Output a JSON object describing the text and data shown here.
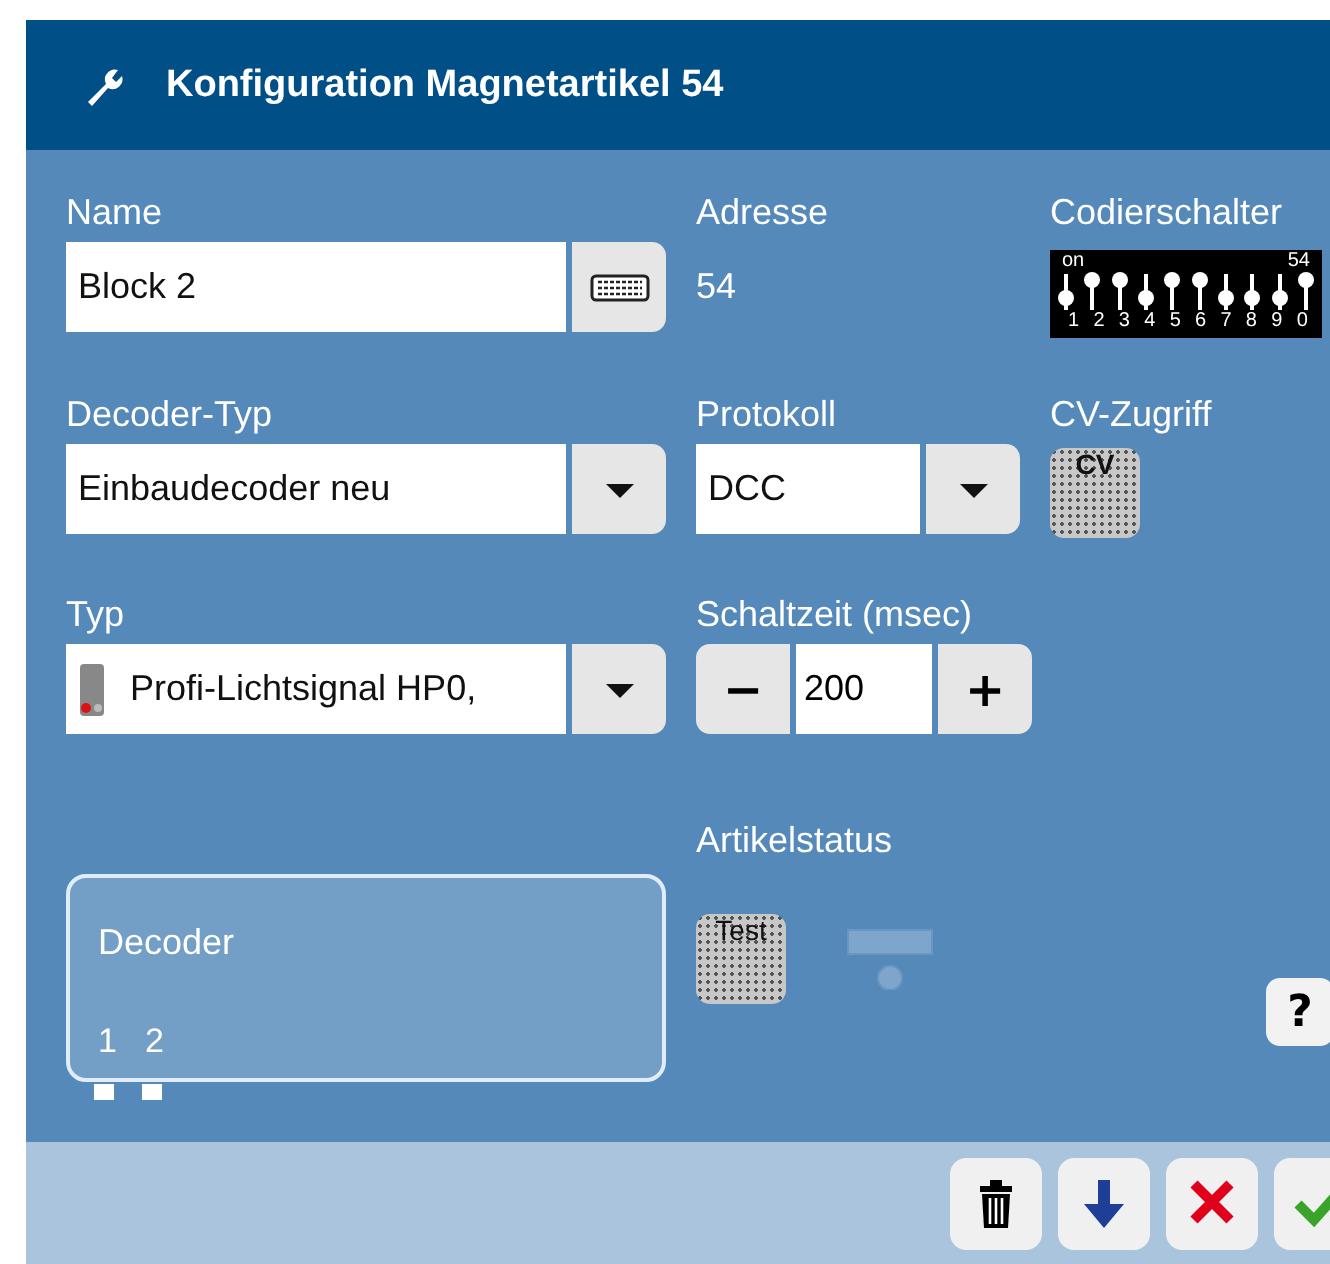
{
  "window": {
    "title": "Konfiguration Magnetartikel 54"
  },
  "fields": [
    {
      "kind": "text",
      "label": "Name",
      "value": "Block 2"
    },
    {
      "kind": "readout",
      "label": "Adresse",
      "value": "54"
    },
    {
      "kind": "dip",
      "label": "Codierschalter",
      "on_label": "on",
      "address": "54",
      "switches": [
        {
          "label": "1",
          "on": false
        },
        {
          "label": "2",
          "on": true
        },
        {
          "label": "3",
          "on": true
        },
        {
          "label": "4",
          "on": false
        },
        {
          "label": "5",
          "on": true
        },
        {
          "label": "6",
          "on": true
        },
        {
          "label": "7",
          "on": false
        },
        {
          "label": "8",
          "on": false
        },
        {
          "label": "9",
          "on": false
        },
        {
          "label": "0",
          "on": true
        }
      ]
    },
    {
      "kind": "select",
      "label": "Decoder-Typ",
      "value": "Einbaudecoder neu"
    },
    {
      "kind": "select",
      "label": "Protokoll",
      "value": "DCC"
    },
    {
      "kind": "tool",
      "label": "CV-Zugriff",
      "button": "CV"
    },
    {
      "kind": "signal_select",
      "label": "Typ",
      "value": "Profi-Lichtsignal HP0,"
    },
    {
      "kind": "stepper",
      "label": "Schaltzeit (msec)",
      "value": "200",
      "minus": "−",
      "plus": "+"
    }
  ],
  "decoder": {
    "title": "Decoder",
    "ports": [
      "1",
      "2"
    ]
  },
  "status": {
    "label": "Artikelstatus",
    "test_button": "Test",
    "active": false
  },
  "help": "?",
  "footer_buttons": [
    {
      "kind": "delete"
    },
    {
      "kind": "down"
    },
    {
      "kind": "cancel"
    },
    {
      "kind": "confirm"
    }
  ]
}
